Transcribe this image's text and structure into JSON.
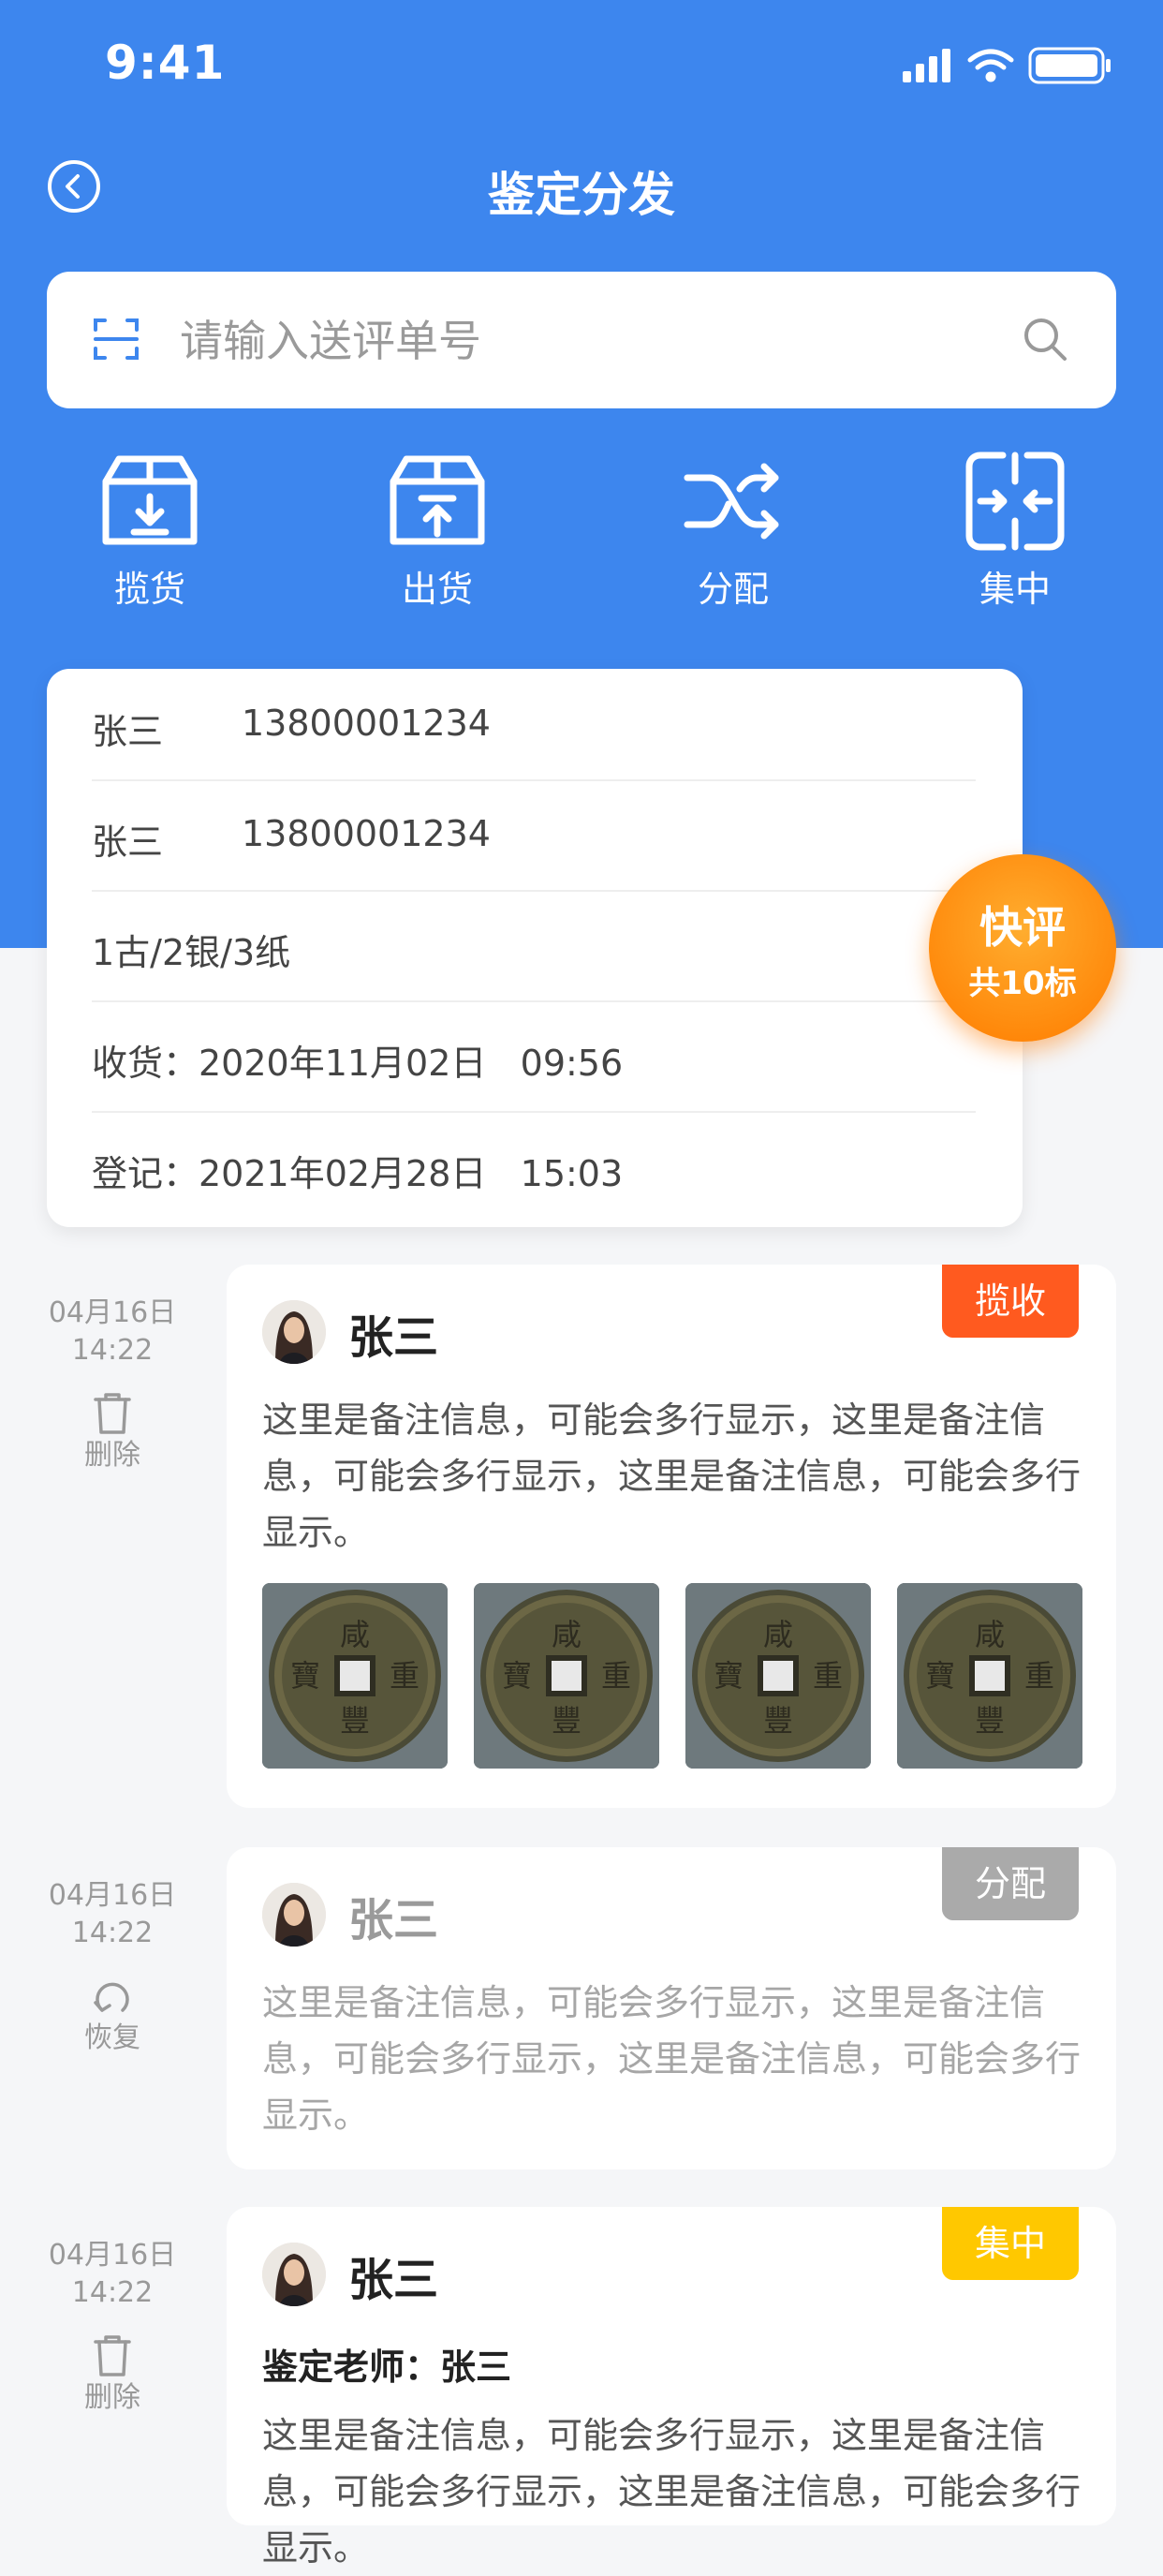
{
  "status_bar": {
    "time": "9:41"
  },
  "nav": {
    "title": "鉴定分发"
  },
  "search": {
    "placeholder": "请输入送评单号"
  },
  "actions": [
    {
      "label": "揽货",
      "icon": "box-download-icon"
    },
    {
      "label": "出货",
      "icon": "box-upload-icon"
    },
    {
      "label": "分配",
      "icon": "shuffle-icon"
    },
    {
      "label": "集中",
      "icon": "merge-icon"
    }
  ],
  "info": {
    "rows": [
      {
        "name": "张三",
        "phone": "13800001234"
      },
      {
        "name": "张三",
        "phone": "13800001234"
      }
    ],
    "category": "1古/2银/3纸",
    "received": "收货：2020年11月02日   09:56",
    "registered": "登记：2021年02月28日   15:03"
  },
  "quick_badge": {
    "title": "快评",
    "count": "共10标"
  },
  "entries": [
    {
      "date": "04月16日",
      "time": "14:22",
      "op_label": "删除",
      "op_icon": "trash-icon",
      "name": "张三",
      "tag": "揽收",
      "note": "这里是备注信息，可能会多行显示，这里是备注信息，可能会多行显示，这里是备注信息，可能会多行显示。"
    },
    {
      "date": "04月16日",
      "time": "14:22",
      "op_label": "恢复",
      "op_icon": "restore-icon",
      "name": "张三",
      "tag": "分配",
      "note": "这里是备注信息，可能会多行显示，这里是备注信息，可能会多行显示，这里是备注信息，可能会多行显示。"
    },
    {
      "date": "04月16日",
      "time": "14:22",
      "op_label": "删除",
      "op_icon": "trash-icon",
      "name": "张三",
      "tag": "集中",
      "teacher": "鉴定老师：张三",
      "note": "这里是备注信息，可能会多行显示，这里是备注信息，可能会多行显示，这里是备注信息，可能会多行显示。"
    }
  ],
  "colors": {
    "primary": "#3d86ee",
    "tag_collect": "#ff5a1f",
    "tag_assign": "#aaaaaa",
    "tag_gather": "#ffc800",
    "badge": "#ff8a0c"
  }
}
